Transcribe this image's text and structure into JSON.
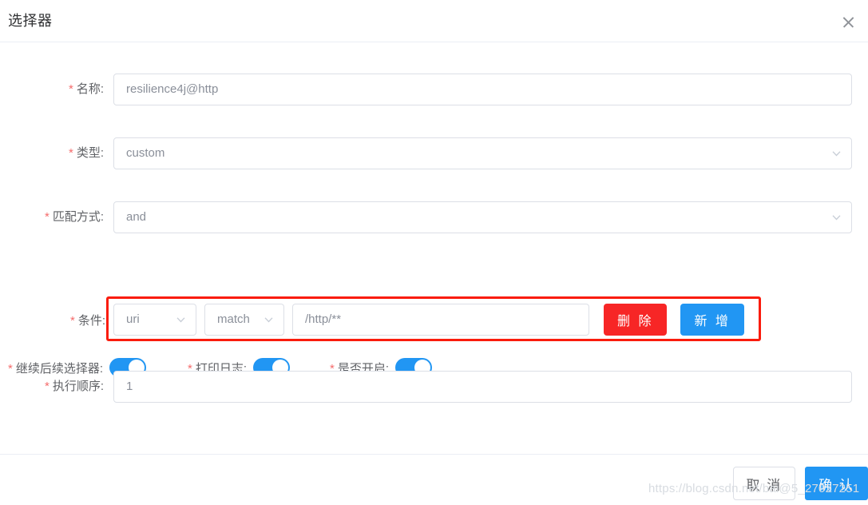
{
  "dialog": {
    "title": "选择器",
    "close_label": "×"
  },
  "form": {
    "name": {
      "label": "名称:",
      "required": true,
      "value": "resilience4j@http"
    },
    "type": {
      "label": "类型:",
      "required": true,
      "value": "custom"
    },
    "match_mode": {
      "label": "匹配方式:",
      "required": true,
      "value": "and"
    },
    "condition": {
      "label": "条件:",
      "required": true,
      "field_value": "uri",
      "operator_value": "match",
      "param_value": "/http/**",
      "delete_label": "删 除",
      "add_label": "新 增",
      "highlight_color": "#fa1c0d"
    },
    "switches": [
      {
        "label": "继续后续选择器:",
        "required": true,
        "on": true
      },
      {
        "label": "打印日志:",
        "required": true,
        "on": true
      },
      {
        "label": "是否开启:",
        "required": true,
        "on": true
      }
    ],
    "sort": {
      "label": "执行顺序:",
      "required": true,
      "value": "1"
    }
  },
  "footer": {
    "cancel_label": "取 消",
    "confirm_label": "确 认"
  },
  "watermark": {
    "text": "https://blog.csdn.net/bai@5_27027251"
  },
  "colors": {
    "primary": "#2196f3",
    "danger": "#f72626",
    "required_star": "#f56c6c",
    "border": "#dcdfe6",
    "text": "#606266"
  }
}
